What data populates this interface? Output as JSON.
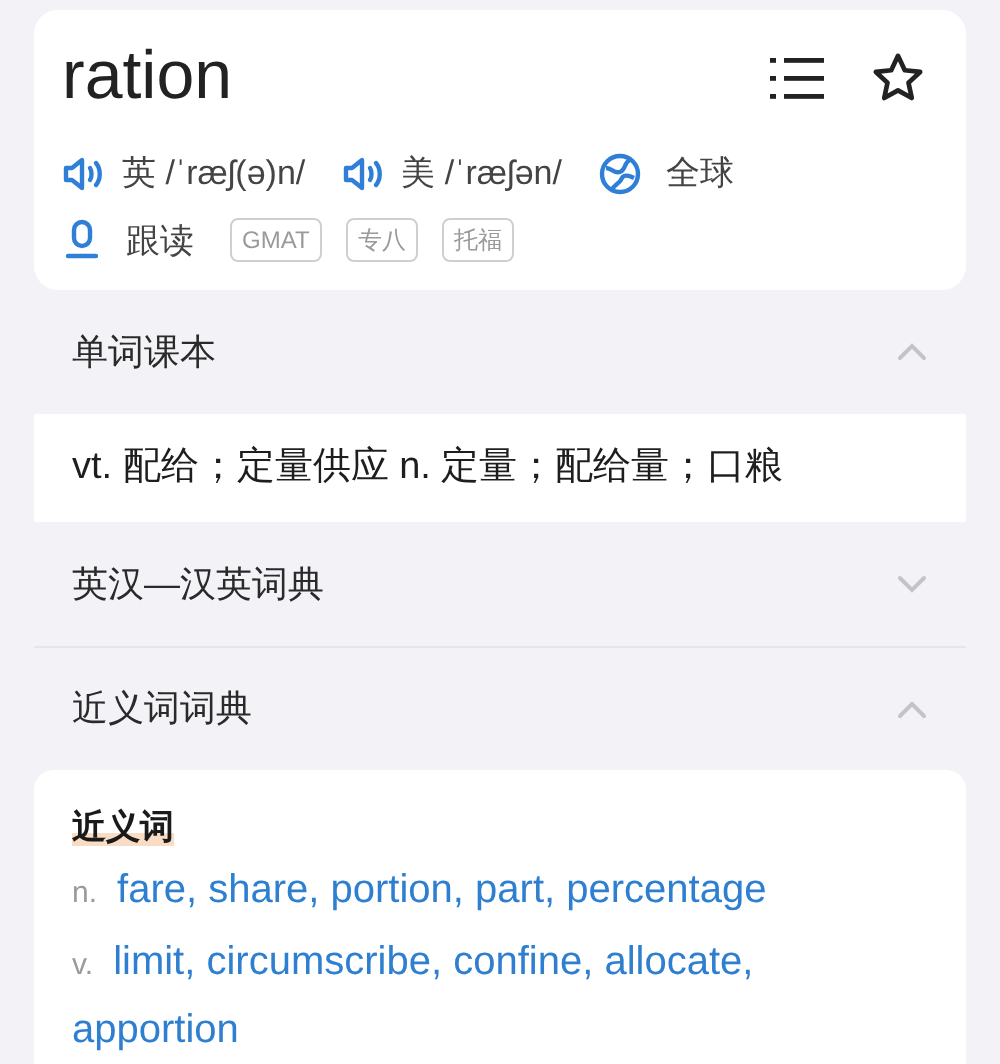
{
  "word": "ration",
  "pronunciations": [
    {
      "region": "英",
      "phonetic": "/ˈræʃ(ə)n/"
    },
    {
      "region": "美",
      "phonetic": "/ˈræʃən/"
    }
  ],
  "global_label": "全球",
  "follow_read": "跟读",
  "tags": [
    "GMAT",
    "专八",
    "托福"
  ],
  "sections": [
    {
      "title": "单词课本",
      "expanded": true,
      "kind": "definition",
      "definition": "vt. 配给；定量供应 n. 定量；配给量；口粮"
    },
    {
      "title": "英汉—汉英词典",
      "expanded": false
    },
    {
      "title": "近义词词典",
      "expanded": true,
      "kind": "synonyms",
      "heading": "近义词",
      "rows": [
        {
          "pos": "n.",
          "words": [
            "fare,",
            "share,",
            "portion,",
            "part,",
            "percentage"
          ]
        },
        {
          "pos": "v.",
          "words": [
            "limit,",
            "circumscribe,",
            "confine,",
            "allocate,",
            "apportion"
          ]
        }
      ]
    }
  ]
}
